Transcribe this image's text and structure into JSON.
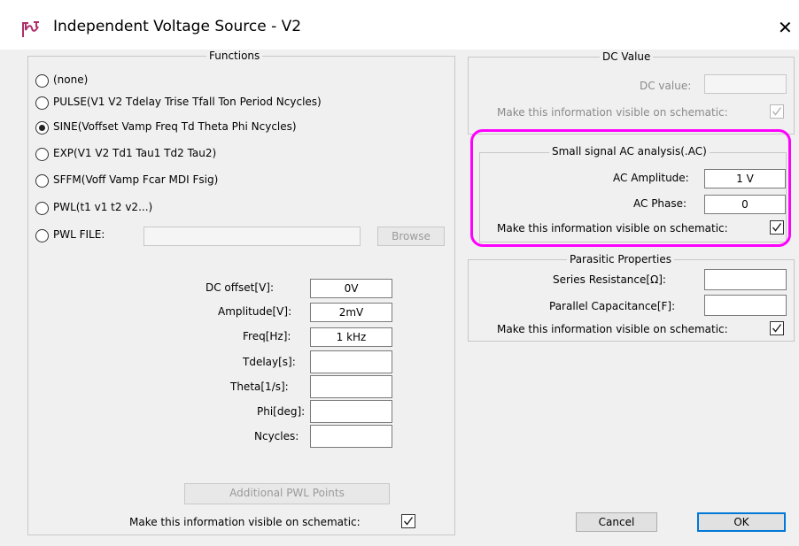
{
  "window": {
    "title": "Independent Voltage Source - V2",
    "close": "✕"
  },
  "functions": {
    "legend": "Functions",
    "options": [
      {
        "label": "(none)",
        "selected": false
      },
      {
        "label": "PULSE(V1  V2 Tdelay Trise Tfall Ton Period Ncycles)",
        "selected": false
      },
      {
        "label": "SINE(Voffset Vamp Freq Td Theta Phi Ncycles)",
        "selected": true
      },
      {
        "label": "EXP(V1  V2 Td1  Tau1  Td2 Tau2)",
        "selected": false
      },
      {
        "label": "SFFM(Voff Vamp Fcar MDI Fsig)",
        "selected": false
      },
      {
        "label": "PWL(t1  v1  t2  v2...)",
        "selected": false
      },
      {
        "label": "PWL FILE:",
        "selected": false
      }
    ],
    "pwl_file_value": "",
    "browse_label": "Browse",
    "params": [
      {
        "label": "DC offset[V]:",
        "value": "0V"
      },
      {
        "label": "Amplitude[V]:",
        "value": "2mV"
      },
      {
        "label": "Freq[Hz]:",
        "value": "1 kHz"
      },
      {
        "label": "Tdelay[s]:",
        "value": ""
      },
      {
        "label": "Theta[1/s]:",
        "value": ""
      },
      {
        "label": "Phi[deg]:",
        "value": ""
      },
      {
        "label": "Ncycles:",
        "value": ""
      }
    ],
    "additional_pwl_label": "Additional PWL Points",
    "visible_label": "Make this information visible on schematic:",
    "visible_checked": true
  },
  "dc": {
    "legend": "DC Value",
    "dc_value_label": "DC value:",
    "dc_value": "",
    "visible_label": "Make this information visible on schematic:",
    "visible_checked": true
  },
  "ac": {
    "legend": "Small signal AC analysis(.AC)",
    "amplitude_label": "AC Amplitude:",
    "amplitude_value": "1 V",
    "phase_label": "AC Phase:",
    "phase_value": "0",
    "visible_label": "Make this information visible on schematic:",
    "visible_checked": true
  },
  "parasitic": {
    "legend": "Parasitic Properties",
    "series_label": "Series Resistance[Ω]:",
    "series_value": "",
    "parallel_label": "Parallel Capacitance[F]:",
    "parallel_value": "",
    "visible_label": "Make this information visible on schematic:",
    "visible_checked": true
  },
  "buttons": {
    "cancel": "Cancel",
    "ok": "OK"
  },
  "colors": {
    "highlight": "#ff00ff",
    "default_button_border": "#0078d7",
    "icon": "#b0306a"
  }
}
